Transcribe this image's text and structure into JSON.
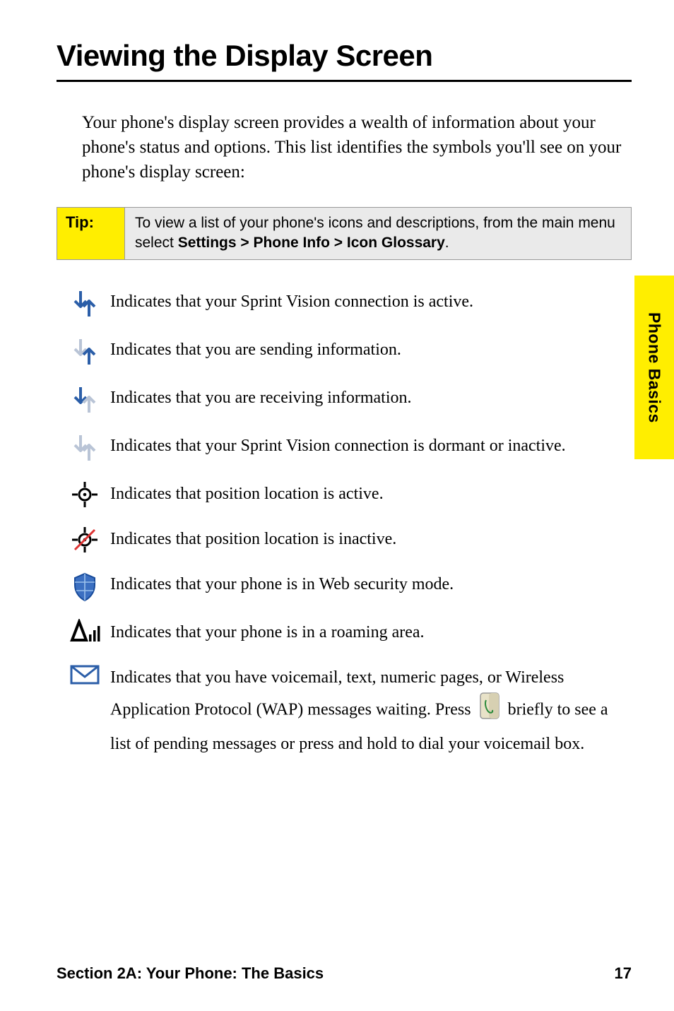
{
  "title": "Viewing the Display Screen",
  "intro": "Your phone's display screen provides a wealth of information about your phone's status and options. This list identifies the symbols you'll see on your phone's display screen:",
  "tip": {
    "label": "Tip:",
    "text_a": "To view a list of your phone's icons and descriptions, from the main menu select ",
    "text_b": "Settings > Phone Info > Icon Glossary",
    "text_c": "."
  },
  "side_tab": "Phone Basics",
  "items": [
    {
      "icon": "vision-active",
      "text": "Indicates that your Sprint Vision connection is active."
    },
    {
      "icon": "vision-sending",
      "text": "Indicates that you are sending information."
    },
    {
      "icon": "vision-receiving",
      "text": "Indicates that you are receiving information."
    },
    {
      "icon": "vision-dormant",
      "text": "Indicates that your Sprint Vision connection is dormant or inactive."
    },
    {
      "icon": "location-active",
      "text": "Indicates that position location is active."
    },
    {
      "icon": "location-inactive",
      "text": "Indicates that position location is inactive."
    },
    {
      "icon": "web-security",
      "text": "Indicates that your phone is in Web security mode."
    },
    {
      "icon": "roaming",
      "text": "Indicates that your phone is in a roaming area."
    },
    {
      "icon": "envelope",
      "text_a": "Indicates that you have voicemail, text, numeric pages, or Wireless Application Protocol (WAP) messages waiting. Press ",
      "text_b": " briefly to see a list of pending messages or press and hold to dial your voicemail box."
    }
  ],
  "footer": {
    "left": "Section 2A: Your Phone: The Basics",
    "right": "17"
  }
}
